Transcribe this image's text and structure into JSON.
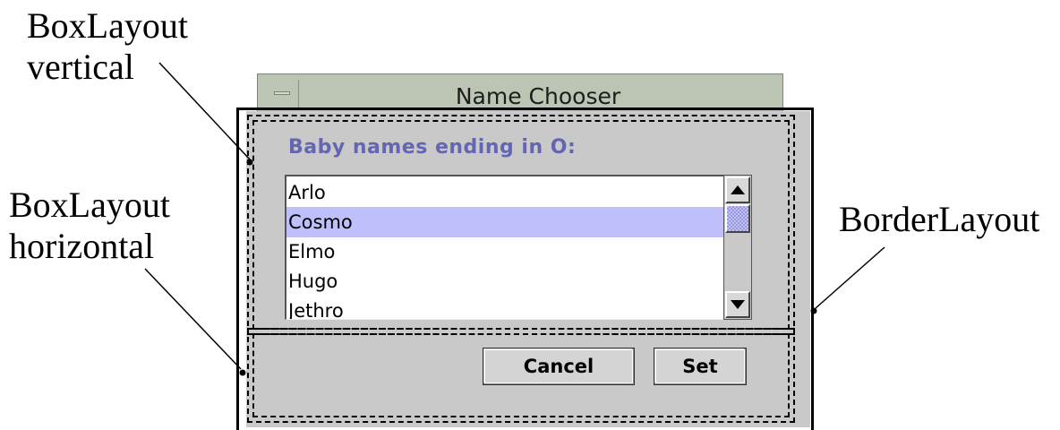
{
  "annotations": {
    "vertical_line1": "BoxLayout",
    "vertical_line2": "vertical",
    "horizontal_line1": "BoxLayout",
    "horizontal_line2": "horizontal",
    "border": "BorderLayout"
  },
  "window": {
    "title": "Name Chooser"
  },
  "list": {
    "heading": "Baby names ending in O:",
    "items": [
      "Arlo",
      "Cosmo",
      "Elmo",
      "Hugo",
      "Jethro"
    ],
    "selected_item": "Cosmo"
  },
  "buttons": {
    "cancel": "Cancel",
    "set": "Set"
  },
  "colors": {
    "heading": "#6466b4",
    "selection": "#bfbffb",
    "window_frame": "#bcc4b4",
    "panel": "#c9c9c9"
  }
}
